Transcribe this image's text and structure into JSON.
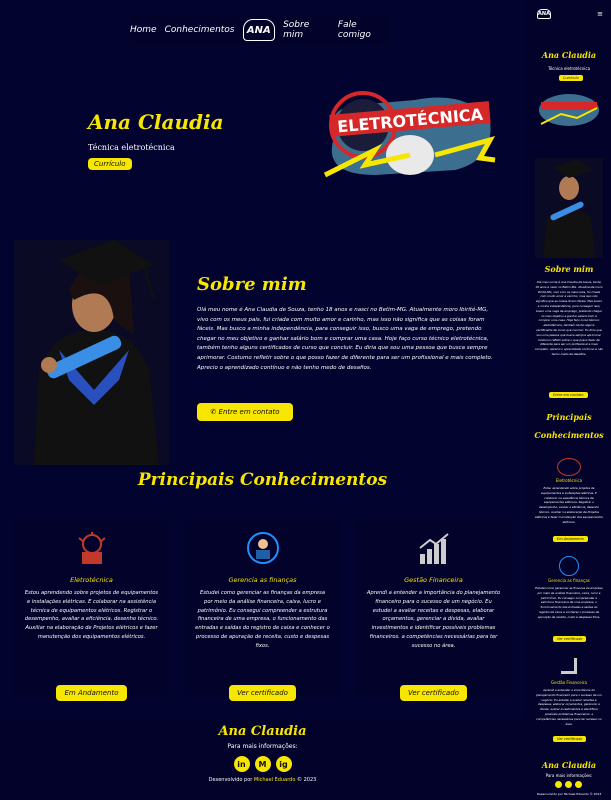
{
  "nav": {
    "left_links": [
      "Home",
      "Conhecimentos"
    ],
    "logo_text": "ANA",
    "right_links": [
      "Sobre mim",
      "Fale comigo"
    ]
  },
  "hero": {
    "name": "Ana Claudia",
    "subtitle": "Técnica eletrotécnica",
    "cv_button": "Currículo",
    "banner_text": "ELETROTÉCNICA"
  },
  "about": {
    "title": "Sobre mim",
    "text": "Olá meu nome é Ana Claudia de Souza, tenho 18 anos e nasci no Betim-MG. Atualmente moro Ibirité-MG, vivo com os meus pais, fui criada com muito amor e carinho, mas isso não significa que as coisas foram fáceis. Mas busco a minha independência, para conseguir isso, busco uma vaga de emprego, pretendo chegar no meu objetivo e ganhar salário bom e comprar uma casa. Hoje faço curso técnico eletrotécnica, também tenho alguns certificados de curso que concluir. Eu diria que sou uma pessoa que busca sempre aprimorar. Costumo refletir sobre o que posso fazer de diferente para ser um profissional e mais completo. Aprecio o aprendizado contínuo e não tenho medo de desafios.",
    "contact_button": "Entre em contato"
  },
  "skills": {
    "title": "Principais Conhecimentos",
    "cards": [
      {
        "title": "Eletrotécnica",
        "text": "Estou aprendendo sobre projetos de equipamentos e instalações elétricas. E colaborar na assistência técnica de equipamentos elétricos. Registrar o desempenho, avaliar a eficiência, desenho técnico. Auxiliar na elaboração de Projetos elétricos e fazer manutenção dos equipamentos elétricos.",
        "button": "Em Andamento"
      },
      {
        "title": "Gerencia as finanças",
        "text": "Estudei como gerenciar as finanças da empresa por meio da análise financeira, caixa, lucro e patrimônio. Eu consegui compreender a estrutura financeira de uma empresa, o funcionamento das entradas e saídas do registro de caixa e conhecer o processo de apuração de receita, custo e despesas fixos.",
        "button": "Ver certificado"
      },
      {
        "title": "Gestão Financeira",
        "text": "Aprendi a entender a importância do planejamento financeiro para o sucesso de um negócio. Eu estudei a avaliar receitas e despesas, elaborar orçamentos, gerenciar a dívida, avaliar investimentos e identificar possíveis problemas financeiros. a competências necessárias para ter sucesso no área.",
        "button": "Ver certificado"
      }
    ]
  },
  "footer": {
    "name": "Ana Claudia",
    "info": "Para mais informações:",
    "socials": [
      "in",
      "M",
      "ig"
    ],
    "credit_prefix": "Desenvolvido por ",
    "credit_author": "Michael Eduardo",
    "credit_suffix": " © 2023"
  },
  "mobile": {
    "logo_text": "ANA",
    "menu_icon": "≡",
    "name": "Ana Claudia",
    "subtitle": "Técnica eletrotécnica",
    "cv_button": "Currículo",
    "about_title": "Sobre mim",
    "contact_button": "Entre em contato",
    "skills_title_line1": "Principais",
    "skills_title_line2": "Conhecimentos",
    "footer_name": "Ana Claudia",
    "footer_info": "Para mais informações:",
    "footer_credit": "Desenvolvido por Michael Eduardo © 2023"
  },
  "colors": {
    "background": "#02022a",
    "accent": "#f7e600",
    "icon_red": "#c0392b",
    "icon_blue": "#1e90ff"
  }
}
